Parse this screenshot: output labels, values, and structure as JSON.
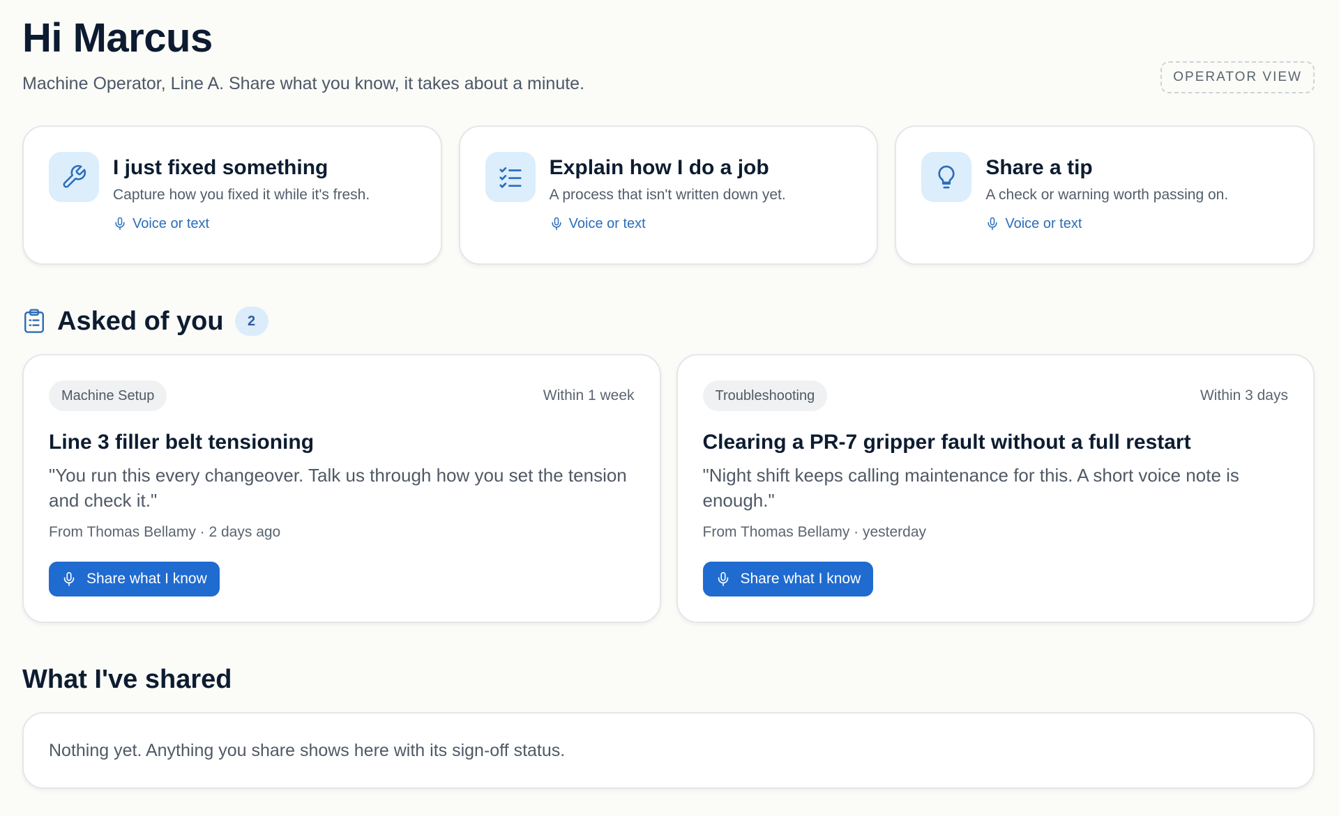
{
  "header": {
    "greeting": "Hi Marcus",
    "subtitle": "Machine Operator, Line A. Share what you know, it takes about a minute.",
    "view_badge": "OPERATOR VIEW"
  },
  "actions": [
    {
      "title": "I just fixed something",
      "description": "Capture how you fixed it while it's fresh.",
      "mode": "Voice or text",
      "icon": "wrench-icon"
    },
    {
      "title": "Explain how I do a job",
      "description": "A process that isn't written down yet.",
      "mode": "Voice or text",
      "icon": "checklist-icon"
    },
    {
      "title": "Share a tip",
      "description": "A check or warning worth passing on.",
      "mode": "Voice or text",
      "icon": "lightbulb-icon"
    }
  ],
  "asked": {
    "title": "Asked of you",
    "count": "2",
    "icon": "clipboard-icon",
    "requests": [
      {
        "tag": "Machine Setup",
        "due": "Within 1 week",
        "title": "Line 3 filler belt tensioning",
        "quote": "\"You run this every changeover. Talk us through how you set the tension and check it.\"",
        "from": "From Thomas Bellamy · 2 days ago",
        "button": "Share what I know"
      },
      {
        "tag": "Troubleshooting",
        "due": "Within 3 days",
        "title": "Clearing a PR-7 gripper fault without a full restart",
        "quote": "\"Night shift keeps calling maintenance for this. A short voice note is enough.\"",
        "from": "From Thomas Bellamy · yesterday",
        "button": "Share what I know"
      }
    ]
  },
  "shared": {
    "title": "What I've shared",
    "empty": "Nothing yet. Anything you share shows here with its sign-off status."
  },
  "colors": {
    "accent": "#1f6bd0",
    "icon_bg": "#dcedfb",
    "text": "#0d1c30",
    "muted": "#4f5965",
    "background": "#fbfbf8"
  }
}
